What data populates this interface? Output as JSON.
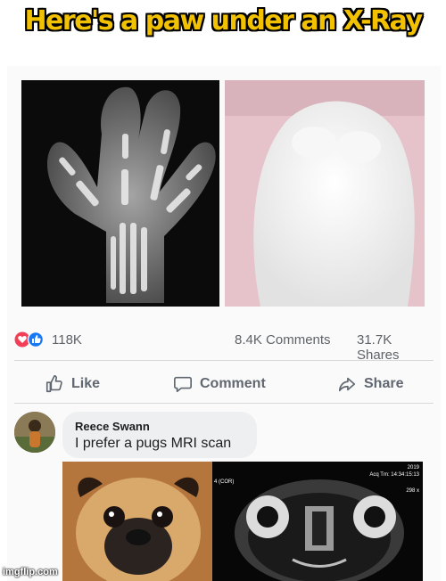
{
  "banner": {
    "title": "Here's a paw under an X-Ray"
  },
  "post": {
    "reactions": {
      "count": "118K",
      "icons": [
        "love-reaction-icon",
        "like-reaction-icon"
      ]
    },
    "comments": "8.4K Comments",
    "shares": "31.7K Shares",
    "actions": {
      "like": "Like",
      "comment": "Comment",
      "share": "Share"
    }
  },
  "comment": {
    "author": "Reece Swann",
    "text": "I prefer a pugs MRI scan",
    "mri_overlay": [
      "2019",
      "Acq Tm: 14:34:15:13",
      "4 (COR)",
      "298 x"
    ]
  },
  "watermark": "imgflip.com",
  "colors": {
    "banner_text": "#f2c200",
    "like_blue": "#1877f2",
    "love_red": "#f33e58",
    "muted": "#606770"
  }
}
